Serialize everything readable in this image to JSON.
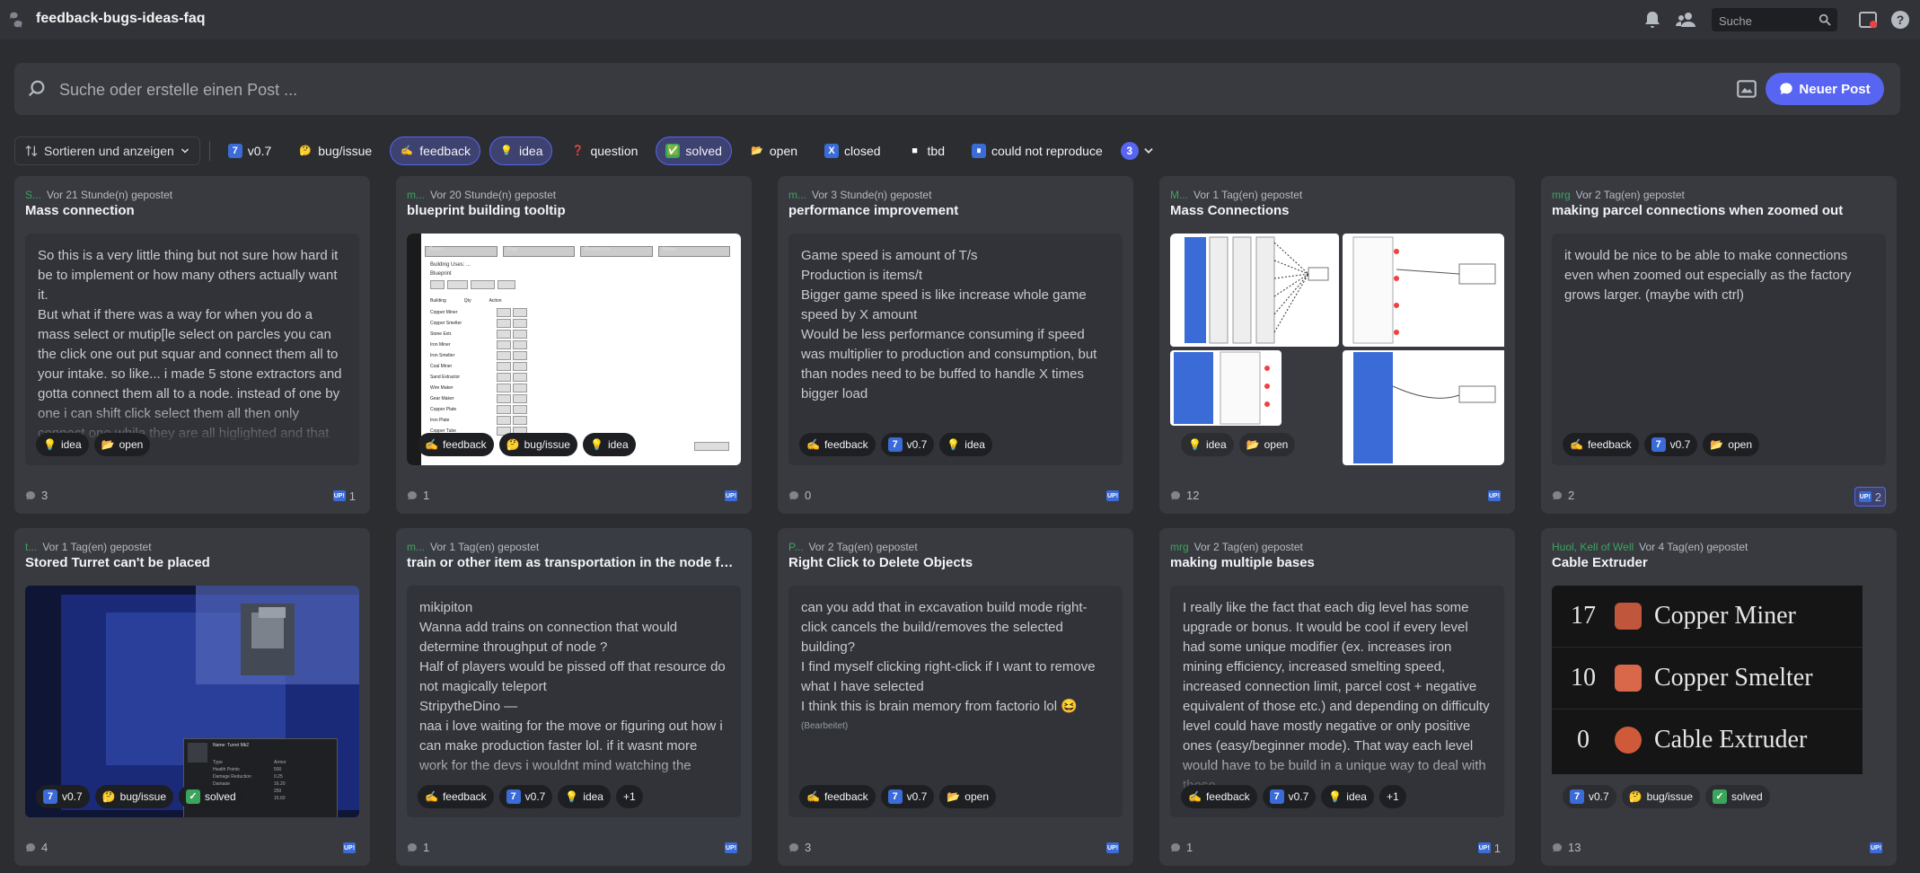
{
  "channel": {
    "title": "feedback-bugs-ideas-faq"
  },
  "search": {
    "placeholder": "Suche"
  },
  "composer": {
    "placeholder": "Suche oder erstelle einen Post ...",
    "new_post_label": "Neuer Post"
  },
  "filters": {
    "sort_label": "Sortieren und anzeigen",
    "tags": [
      {
        "emoji": "7",
        "label": "v0.7",
        "selected": false
      },
      {
        "emoji": "🤔",
        "label": "bug/issue",
        "selected": false
      },
      {
        "emoji": "✍",
        "label": "feedback",
        "selected": true
      },
      {
        "emoji": "💡",
        "label": "idea",
        "selected": true
      },
      {
        "emoji": "❓",
        "label": "question",
        "selected": false
      },
      {
        "emoji": "✅",
        "label": "solved",
        "selected": true
      },
      {
        "emoji": "📂",
        "label": "open",
        "selected": false
      },
      {
        "emoji": "X",
        "label": "closed",
        "selected": false
      },
      {
        "emoji": "■",
        "label": "tbd",
        "selected": false
      },
      {
        "emoji": "⏸",
        "label": "could not reproduce",
        "selected": false
      }
    ],
    "more_count": "3"
  },
  "colors": {
    "accent": "#5865f2",
    "author_green": "#3ba55c"
  },
  "posts": [
    {
      "author": "S...",
      "time": "Vor 21 Stunde(n) gepostet",
      "title": "Mass connection",
      "lines": [
        "So this is a very little thing but not sure how hard it be to implement or how many others actually want it.",
        "But what if there was a way for when you do a mass select or mutip[le select on parcles you can the click one out put squar and connect them all to your intake. so like... i made 5 stone extractors and gotta connect them all to a node. instead of one by one i can shift click select them all then only connect one while they are all higlighted and that"
      ],
      "tags": [
        "idea",
        "open"
      ],
      "messages": "3",
      "upvotes": "1"
    },
    {
      "author": "m...",
      "time": "Vor 20 Stunde(n) gepostet",
      "title": "blueprint building tooltip",
      "tags": [
        "feedback",
        "bug/issue",
        "idea"
      ],
      "messages": "1",
      "upvotes": ""
    },
    {
      "author": "m...",
      "time": "Vor 3 Stunde(n) gepostet",
      "title": "performance improvement",
      "lines": [
        "Game speed is amount of T/s",
        "Production is items/t",
        "Bigger game speed is like increase whole game speed by X amount",
        "Would be less performance consuming if speed was multiplier to production and consumption, but than nodes need to be buffed to handle X times bigger load"
      ],
      "tags": [
        "feedback",
        "v0.7",
        "idea"
      ],
      "messages": "0",
      "upvotes": ""
    },
    {
      "author": "M...",
      "time": "Vor 1 Tag(en) gepostet",
      "title": "Mass Connections",
      "tags": [
        "idea",
        "open"
      ],
      "messages": "12",
      "upvotes": ""
    },
    {
      "author": "mrg",
      "time": "Vor 2 Tag(en) gepostet",
      "title": "making parcel connections when zoomed out",
      "lines": [
        "it would be nice to be able to make connections even when zoomed out especially as the factory grows larger. (maybe with ctrl)"
      ],
      "tags": [
        "feedback",
        "v0.7",
        "open"
      ],
      "messages": "2",
      "upvotes": "2"
    },
    {
      "author": "t...",
      "time": "Vor 1 Tag(en) gepostet",
      "title": "Stored Turret can't be placed",
      "tags": [
        "v0.7",
        "bug/issue",
        "solved"
      ],
      "messages": "4",
      "upvotes": ""
    },
    {
      "author": "m...",
      "time": "Vor 1 Tag(en) gepostet",
      "title": "train or other item as transportation in the node for ...",
      "lines": [
        "mikipiton",
        "Wanna add trains on connection that would determine throughput of node ?",
        "Half of players would be pissed off that resource do not magically teleport",
        "StripytheDino —",
        "naa i love waiting for the move or figuring out how i can make production faster lol. if it wasnt more work for the devs i wouldnt mind watching the"
      ],
      "tags": [
        "feedback",
        "v0.7",
        "idea",
        "+1"
      ],
      "messages": "1",
      "upvotes": ""
    },
    {
      "author": "P...",
      "time": "Vor 2 Tag(en) gepostet",
      "title": "Right Click to Delete Objects",
      "lines": [
        "can you add that in excavation build mode right-click cancels the build/removes the selected building?",
        "I find myself clicking right-click if I want to remove what I have selected",
        "I think this is brain memory from factorio lol 😆"
      ],
      "edited": "(Bearbeitet)",
      "tags": [
        "feedback",
        "v0.7",
        "open"
      ],
      "messages": "3",
      "upvotes": ""
    },
    {
      "author": "mrg",
      "time": "Vor 2 Tag(en) gepostet",
      "title": "making multiple bases",
      "lines": [
        "I really like the fact that each dig level has some upgrade or bonus. It would be cool if every level had some unique modifier  (ex. increases iron mining efficiency, increased smelting speed, increased connection limit, parcel cost + negative equivalent of those etc.) and depending on difficulty level could have mostly negative or only positive ones (easy/beginner mode). That way each level would have to be build in a unique way to deal with those"
      ],
      "tags": [
        "feedback",
        "v0.7",
        "idea",
        "+1"
      ],
      "messages": "1",
      "upvotes": "1"
    },
    {
      "author": "Huol, Kell of Well",
      "time": "Vor 4 Tag(en) gepostet",
      "title": "Cable Extruder",
      "table": [
        {
          "num": "17",
          "label": "Copper Miner",
          "color": "#c0563b"
        },
        {
          "num": "10",
          "label": "Copper Smelter",
          "color": "#d9684a"
        },
        {
          "num": "0",
          "label": "Cable Extruder",
          "color": "#cf5a3a"
        }
      ],
      "tags": [
        "v0.7",
        "bug/issue",
        "solved"
      ],
      "messages": "13",
      "upvotes": ""
    }
  ],
  "shot_blueprint": {
    "tabs": [
      "Room",
      "Map",
      "Resources",
      "Menu"
    ],
    "subtitle": "Building Uses: ...",
    "heading": "Blueprint",
    "buttons": [
      "Info",
      "Delete",
      "Rename",
      "Done"
    ],
    "col_building": "Building",
    "col_qty": "Qty",
    "col_action": "Action",
    "rows": [
      "Copper Miner",
      "Copper Smelter",
      "Stone Extr.",
      "Iron Miner",
      "Iron Smelter",
      "Coal Miner",
      "Sand Extractor",
      "Wire Maker",
      "Gear Maker",
      "Copper Plate",
      "Iron Plate",
      "Copper Tube"
    ],
    "footer_btn": "Store Building"
  },
  "shot_turret": {
    "name": "Name: Turret Mk2",
    "stats": [
      "Type",
      "Health Points",
      "Damage Reduction",
      "Damage",
      "Range",
      "Fire Rate"
    ],
    "values": [
      "Armor",
      "500",
      "0.25",
      "16.20",
      "250",
      "15.60"
    ]
  }
}
